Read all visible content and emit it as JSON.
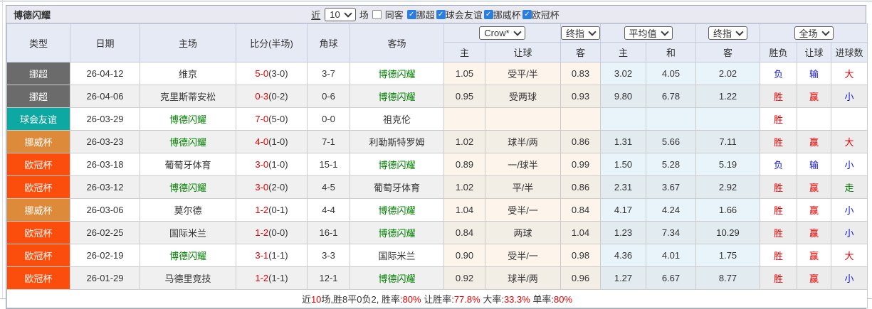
{
  "title": {
    "team": "博德闪耀"
  },
  "controls": {
    "recent_label": "近",
    "recent_value": "10",
    "matches_label": "场",
    "same_venue_label": "同客",
    "same_venue_checked": false,
    "leagues": [
      {
        "label": "挪超",
        "checked": true
      },
      {
        "label": "球会友谊",
        "checked": true
      },
      {
        "label": "挪威杯",
        "checked": true
      },
      {
        "label": "欧冠杯",
        "checked": true
      }
    ]
  },
  "selects": {
    "odds_company": "Crow*",
    "odds_company_time": "终指",
    "avg_type": "平均值",
    "avg_time": "终指",
    "scope": "全场"
  },
  "table": {
    "columns": [
      "类型",
      "日期",
      "主场",
      "比分(半场)",
      "角球",
      "客场"
    ],
    "sub_columns": [
      "主",
      "让球",
      "客",
      "主",
      "和",
      "客",
      "胜负",
      "让球",
      "进球数"
    ],
    "rows": [
      {
        "league": "挪超",
        "date": "26-04-12",
        "home": "维京",
        "home_hl": false,
        "score": "5-0",
        "half": "(3-0)",
        "corner": "3-7",
        "away": "博德闪耀",
        "away_hl": true,
        "crow": [
          "1.05",
          "受平/半",
          "0.83"
        ],
        "avg": [
          "3.02",
          "4.05",
          "2.02"
        ],
        "result": [
          [
            "负",
            "blue"
          ],
          [
            "输",
            "blue"
          ],
          [
            "大",
            "red"
          ]
        ]
      },
      {
        "league": "挪超",
        "date": "26-04-06",
        "home": "克里斯蒂安松",
        "home_hl": false,
        "score": "0-3",
        "half": "(0-2)",
        "corner": "0-6",
        "away": "博德闪耀",
        "away_hl": true,
        "crow": [
          "0.95",
          "受两球",
          "0.93"
        ],
        "avg": [
          "9.80",
          "6.78",
          "1.22"
        ],
        "result": [
          [
            "胜",
            "red"
          ],
          [
            "赢",
            "red"
          ],
          [
            "小",
            "blue"
          ]
        ]
      },
      {
        "league": "球会友谊",
        "date": "26-03-29",
        "home": "博德闪耀",
        "home_hl": true,
        "score": "7-0",
        "half": "(5-0)",
        "corner": "0-0",
        "away": "祖克伦",
        "away_hl": false,
        "crow": [
          "",
          "",
          ""
        ],
        "avg": [
          "",
          "",
          ""
        ],
        "result": [
          [
            "胜",
            "red"
          ],
          [
            "",
            ""
          ],
          [
            "",
            ""
          ]
        ]
      },
      {
        "league": "挪威杯",
        "date": "26-03-23",
        "home": "博德闪耀",
        "home_hl": true,
        "score": "4-0",
        "half": "(1-0)",
        "corner": "7-1",
        "away": "利勒斯特罗姆",
        "away_hl": false,
        "crow": [
          "1.02",
          "球半/两",
          "0.86"
        ],
        "avg": [
          "1.31",
          "5.66",
          "7.11"
        ],
        "result": [
          [
            "胜",
            "red"
          ],
          [
            "赢",
            "red"
          ],
          [
            "大",
            "red"
          ]
        ]
      },
      {
        "league": "欧冠杯",
        "date": "26-03-18",
        "home": "葡萄牙体育",
        "home_hl": false,
        "score": "3-0",
        "half": "(1-0)",
        "corner": "15-1",
        "away": "博德闪耀",
        "away_hl": true,
        "crow": [
          "0.89",
          "一/球半",
          "0.99"
        ],
        "avg": [
          "1.50",
          "5.28",
          "5.19"
        ],
        "result": [
          [
            "负",
            "blue"
          ],
          [
            "输",
            "blue"
          ],
          [
            "小",
            "blue"
          ]
        ]
      },
      {
        "league": "欧冠杯",
        "date": "26-03-12",
        "home": "博德闪耀",
        "home_hl": true,
        "score": "3-0",
        "half": "(2-0)",
        "corner": "4-5",
        "away": "葡萄牙体育",
        "away_hl": false,
        "crow": [
          "1.02",
          "平/半",
          "0.86"
        ],
        "avg": [
          "2.31",
          "3.67",
          "2.92"
        ],
        "result": [
          [
            "胜",
            "red"
          ],
          [
            "赢",
            "red"
          ],
          [
            "走",
            "green"
          ]
        ]
      },
      {
        "league": "挪威杯",
        "date": "26-03-06",
        "home": "莫尔德",
        "home_hl": false,
        "score": "1-2",
        "half": "(0-1)",
        "corner": "4-4",
        "away": "博德闪耀",
        "away_hl": true,
        "crow": [
          "1.04",
          "受半/一",
          "0.84"
        ],
        "avg": [
          "4.17",
          "4.24",
          "1.66"
        ],
        "result": [
          [
            "胜",
            "red"
          ],
          [
            "赢",
            "red"
          ],
          [
            "小",
            "blue"
          ]
        ]
      },
      {
        "league": "欧冠杯",
        "date": "26-02-25",
        "home": "国际米兰",
        "home_hl": false,
        "score": "1-2",
        "half": "(0-0)",
        "corner": "16-1",
        "away": "博德闪耀",
        "away_hl": true,
        "crow": [
          "0.84",
          "两球",
          "1.04"
        ],
        "avg": [
          "1.23",
          "7.34",
          "10.29"
        ],
        "result": [
          [
            "胜",
            "red"
          ],
          [
            "赢",
            "red"
          ],
          [
            "小",
            "blue"
          ]
        ]
      },
      {
        "league": "欧冠杯",
        "date": "26-02-19",
        "home": "博德闪耀",
        "home_hl": true,
        "score": "3-1",
        "half": "(1-1)",
        "corner": "3-3",
        "away": "国际米兰",
        "away_hl": false,
        "crow": [
          "0.90",
          "受半/一",
          "0.98"
        ],
        "avg": [
          "4.36",
          "4.01",
          "1.75"
        ],
        "result": [
          [
            "胜",
            "red"
          ],
          [
            "赢",
            "red"
          ],
          [
            "大",
            "red"
          ]
        ]
      },
      {
        "league": "欧冠杯",
        "date": "26-01-29",
        "home": "马德里竞技",
        "home_hl": false,
        "score": "1-2",
        "half": "(1-1)",
        "corner": "12-1",
        "away": "博德闪耀",
        "away_hl": true,
        "crow": [
          "0.92",
          "球半/两",
          "0.96"
        ],
        "avg": [
          "1.27",
          "6.67",
          "8.77"
        ],
        "result": [
          [
            "胜",
            "red"
          ],
          [
            "赢",
            "red"
          ],
          [
            "小",
            "blue"
          ]
        ]
      }
    ]
  },
  "summary": {
    "segments": [
      [
        "近",
        "dark"
      ],
      [
        "10",
        "red"
      ],
      [
        "场,胜8平0负2, 胜率:",
        "dark"
      ],
      [
        "80%",
        "red"
      ],
      [
        " 让胜率:",
        "dark"
      ],
      [
        "77.8%",
        "red"
      ],
      [
        " 大率:",
        "dark"
      ],
      [
        "33.3%",
        "red"
      ],
      [
        " 单率:",
        "dark"
      ],
      [
        "80%",
        "red"
      ]
    ]
  },
  "colors": {
    "league": {
      "挪超": "#6B6B6B",
      "球会友谊": "#0EA8A2",
      "挪威杯": "#DE8A3B",
      "欧冠杯": "#FB4E0C"
    },
    "team_highlight": "#008000",
    "score": "#E60000",
    "red": "#E60000",
    "blue": "#1717CC",
    "green": "#008000",
    "dark": "#333333",
    "checkbox_accent": "#2A7DE1"
  }
}
